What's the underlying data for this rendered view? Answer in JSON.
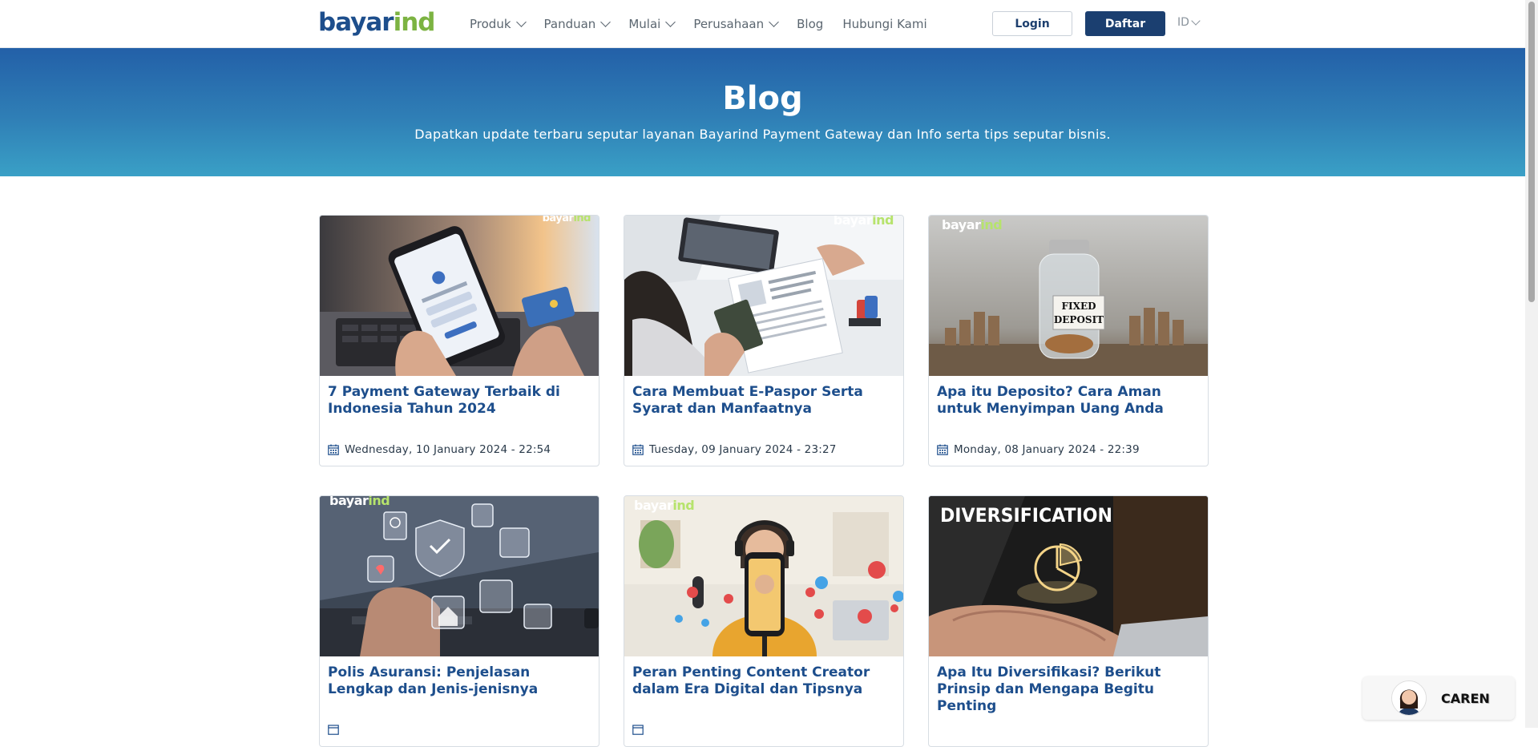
{
  "header": {
    "logo_part1": "bayar",
    "logo_part2": "ind",
    "nav": [
      {
        "label": "Produk",
        "dropdown": true
      },
      {
        "label": "Panduan",
        "dropdown": true
      },
      {
        "label": "Mulai",
        "dropdown": true
      },
      {
        "label": "Perusahaan",
        "dropdown": true
      },
      {
        "label": "Blog",
        "dropdown": false
      },
      {
        "label": "Hubungi Kami",
        "dropdown": false
      }
    ],
    "login_label": "Login",
    "register_label": "Daftar",
    "language": "ID"
  },
  "hero": {
    "title": "Blog",
    "subtitle": "Dapatkan update terbaru seputar layanan Bayarind Payment Gateway dan Info serta tips seputar bisnis."
  },
  "watermark": {
    "part1": "bayar",
    "part2": "ind"
  },
  "posts": [
    {
      "title": "7 Payment Gateway Terbaik di Indonesia Tahun 2024",
      "date": "Wednesday, 10 January 2024 - 22:54",
      "image": "phone-payment-photo"
    },
    {
      "title": "Cara Membuat E-Paspor Serta Syarat dan Manfaatnya",
      "date": "Tuesday, 09 January 2024 - 23:27",
      "image": "passport-application-photo"
    },
    {
      "title": "Apa itu Deposito? Cara Aman untuk Menyimpan Uang Anda",
      "date": "Monday, 08 January 2024 - 22:39",
      "image": "fixed-deposit-jar-photo",
      "image_text_1": "FIXED",
      "image_text_2": "DEPOSIT"
    },
    {
      "title": "Polis Asuransi: Penjelasan Lengkap dan Jenis-jenisnya",
      "date": "",
      "image": "insurance-icons-photo"
    },
    {
      "title": "Peran Penting Content Creator dalam Era Digital dan Tipsnya",
      "date": "",
      "image": "content-creator-photo"
    },
    {
      "title": "Apa Itu Diversifikasi? Berikut Prinsip dan Mengapa Begitu Penting",
      "date": "",
      "image": "diversification-hand-photo",
      "image_text_1": "DIVERSIFICATION"
    }
  ],
  "chat_widget": {
    "name": "CAREN"
  },
  "colors": {
    "brand_blue": "#1d4e8c",
    "brand_green": "#7cb342",
    "hero_top": "#2360a8",
    "hero_bottom": "#3aa0c6",
    "button_dark": "#1b3f70"
  }
}
